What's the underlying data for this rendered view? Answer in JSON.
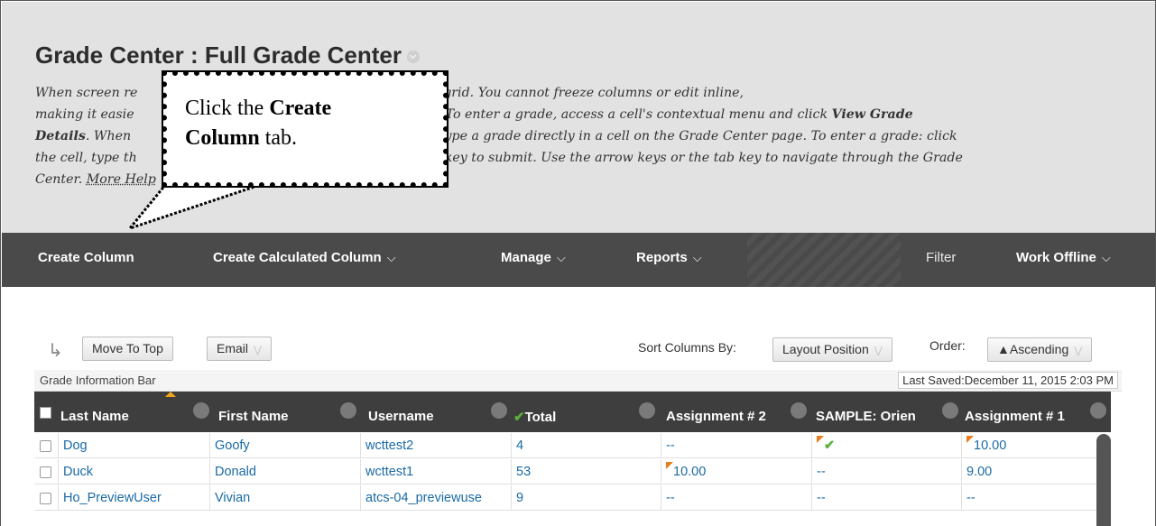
{
  "header": {
    "title": "Grade Center : Full Grade Center",
    "help": {
      "line1_a": "When screen re",
      "line1_b": " data appears in a simplified grid. You cannot freeze columns or edit inline,",
      "line2_a": "making it easie",
      "line2_b": "To enter a grade, access a cell's contextual menu and click ",
      "line2_bold": "View Grade",
      "line3_bold": "Details",
      "line3_a": ". When",
      "line3_b": "n type a grade directly in a cell on the Grade Center page. To enter a grade: click",
      "line4_a": "the cell, type th",
      "line4_b": "key to submit. Use the arrow keys or the tab key to navigate through the Grade",
      "line5_a": "Center. ",
      "more_help": "More Help"
    }
  },
  "callout": {
    "text_pre": "Click the ",
    "bold1": "Create",
    "bold2": "Column",
    "text_post": " tab."
  },
  "nav": {
    "create_column": "Create Column",
    "create_calculated": "Create Calculated Column",
    "manage": "Manage",
    "reports": "Reports",
    "filter": "Filter",
    "work_offline": "Work Offline",
    "chevron": "⌵"
  },
  "toolbar": {
    "move_to_top": "Move To Top",
    "email": "Email",
    "sort_label": "Sort Columns By:",
    "sort_value": "Layout Position",
    "order_label": "Order:",
    "order_value": "▲Ascending"
  },
  "infobar": {
    "left": "Grade Information Bar",
    "last_saved": "Last Saved:December 11, 2015 2:03 PM"
  },
  "table": {
    "headers": [
      "Last Name",
      "First Name",
      "Username",
      "Total",
      "Assignment # 2",
      "SAMPLE: Orien",
      "Assignment # 1"
    ],
    "rows": [
      [
        "Dog",
        "Goofy",
        "wcttest2",
        "4",
        "--",
        "",
        "10.00"
      ],
      [
        "Duck",
        "Donald",
        "wcttest1",
        "53",
        "10.00",
        "--",
        "9.00"
      ],
      [
        "Ho_PreviewUser",
        "Vivian",
        "atcs-04_previewuse",
        "9",
        "--",
        "--",
        "--"
      ]
    ]
  },
  "colors": {
    "navbar": "#4a4a4a",
    "header_bg": "#e2e2e2",
    "grid_header": "#3e3e3e",
    "link": "#1a6aa4",
    "flag": "#e87d1e",
    "check": "#5db13c"
  }
}
